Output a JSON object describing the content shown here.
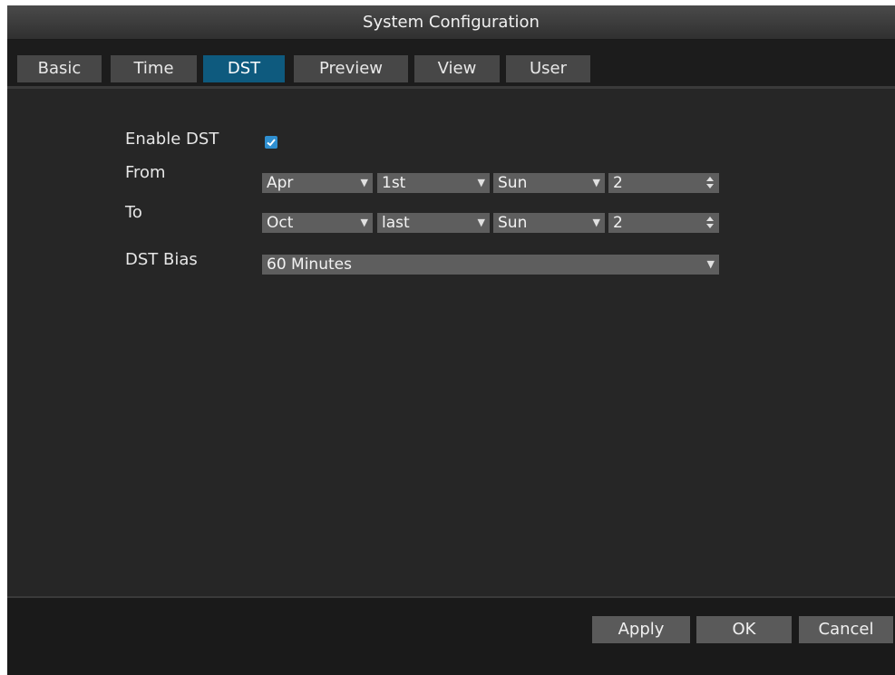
{
  "window": {
    "title": "System Configuration"
  },
  "tabs": [
    {
      "label": "Basic",
      "active": false
    },
    {
      "label": "Time",
      "active": false
    },
    {
      "label": "DST",
      "active": true
    },
    {
      "label": "Preview",
      "active": false
    },
    {
      "label": "View",
      "active": false
    },
    {
      "label": "User",
      "active": false
    }
  ],
  "form": {
    "enable_dst": {
      "label": "Enable DST",
      "checked": true
    },
    "from": {
      "label": "From",
      "month": "Apr",
      "week": "1st",
      "day": "Sun",
      "hour": "2"
    },
    "to": {
      "label": "To",
      "month": "Oct",
      "week": "last",
      "day": "Sun",
      "hour": "2"
    },
    "dst_bias": {
      "label": "DST Bias",
      "value": "60 Minutes"
    }
  },
  "buttons": {
    "apply": "Apply",
    "ok": "OK",
    "cancel": "Cancel"
  },
  "colors": {
    "accent": "#0e5a7e",
    "checkbox": "#2f8fd0",
    "background": "#262626"
  }
}
